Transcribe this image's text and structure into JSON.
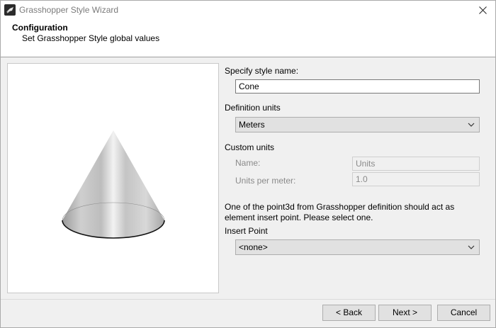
{
  "window": {
    "title": "Grasshopper Style Wizard",
    "icon": "app-logo-icon",
    "close_glyph": "✕"
  },
  "header": {
    "title": "Configuration",
    "subtitle": "Set Grasshopper Style global values"
  },
  "preview": {
    "icon": "cone-preview-image"
  },
  "form": {
    "style_name_label": "Specify style name:",
    "style_name_value": "Cone",
    "definition_units_label": "Definition units",
    "definition_units_value": "Meters",
    "custom_units_label": "Custom units",
    "name_label": "Name:",
    "name_value": "Units",
    "units_per_meter_label": "Units per meter:",
    "units_per_meter_value": "1.0",
    "info_text": "One of the point3d from Grasshopper definition should act as element insert point. Please select one.",
    "insert_point_label": "Insert Point",
    "insert_point_value": "<none>"
  },
  "footer": {
    "back_label": "< Back",
    "next_label": "Next >",
    "cancel_label": "Cancel"
  }
}
